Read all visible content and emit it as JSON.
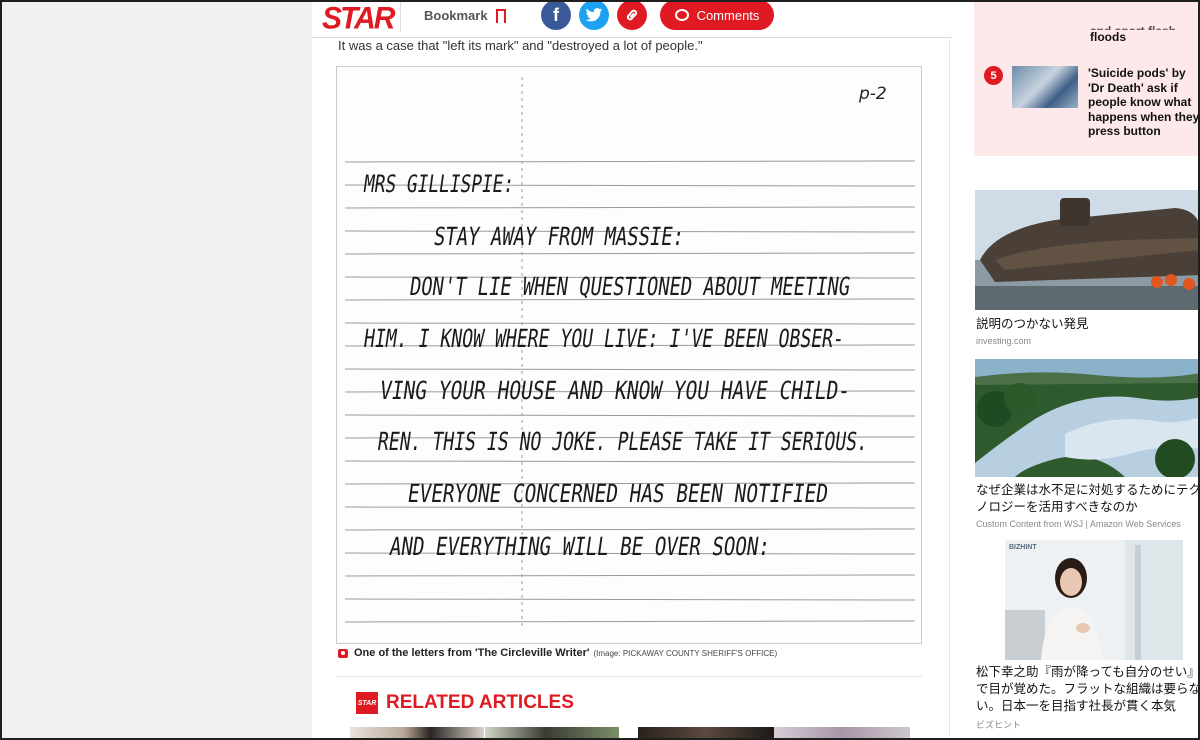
{
  "header": {
    "logo": "STAR",
    "bookmark_label": "Bookmark",
    "comments_label": "Comments",
    "facebook_glyph": "f",
    "twitter_glyph": "t",
    "link_glyph": "🔗"
  },
  "article": {
    "intro": "It was a case that \"left its mark\" and \"destroyed a lot of people.\"",
    "letter": {
      "page_mark": "p-2",
      "lines": [
        "MRS GILLISPIE:",
        "STAY AWAY FROM MASSIE:",
        "DON'T LIE WHEN QUESTIONED ABOUT MEETING",
        "HIM. I KNOW WHERE YOU LIVE: I'VE BEEN OBSER-",
        "VING YOUR HOUSE AND KNOW YOU HAVE CHILD-",
        "REN. THIS IS NO JOKE. PLEASE TAKE IT SERIOUS.",
        "EVERYONE CONCERNED HAS BEEN NOTIFIED",
        "AND EVERYTHING WILL BE OVER SOON:"
      ]
    },
    "caption": "One of the letters from 'The Circleville Writer'",
    "caption_credit": "(Image: PICKAWAY COUNTY SHERIFF'S OFFICE)",
    "related_logo": "STAR",
    "related_title": "RELATED ARTICLES"
  },
  "sidebar": {
    "trending_prev_tail": "floods",
    "trending_prev_partial": "and sport flash",
    "trending_item": {
      "number": "5",
      "title": "'Suicide pods' by 'Dr Death' ask if people know what happens when they press button"
    },
    "ads": [
      {
        "title": "説明のつかない発見",
        "source": "investing.com"
      },
      {
        "title_line1": "なぜ企業は水不足に対処するためにテク",
        "title_line2": "ノロジーを活用すべきなのか",
        "source": "Custom Content from WSJ | Amazon Web Services"
      },
      {
        "badge": "BIZHINT",
        "title_line1": "松下幸之助『雨が降っても自分のせい』",
        "title_line2": "で目が覚めた。フラットな組織は要らな",
        "title_line3": "い。日本一を目指す社長が貫く本気",
        "source": "ビズヒント"
      }
    ]
  },
  "colors": {
    "brand_red": "#e01a22",
    "facebook": "#3b5998",
    "twitter": "#1da1f2",
    "trending_bg": "#fde8ea"
  }
}
